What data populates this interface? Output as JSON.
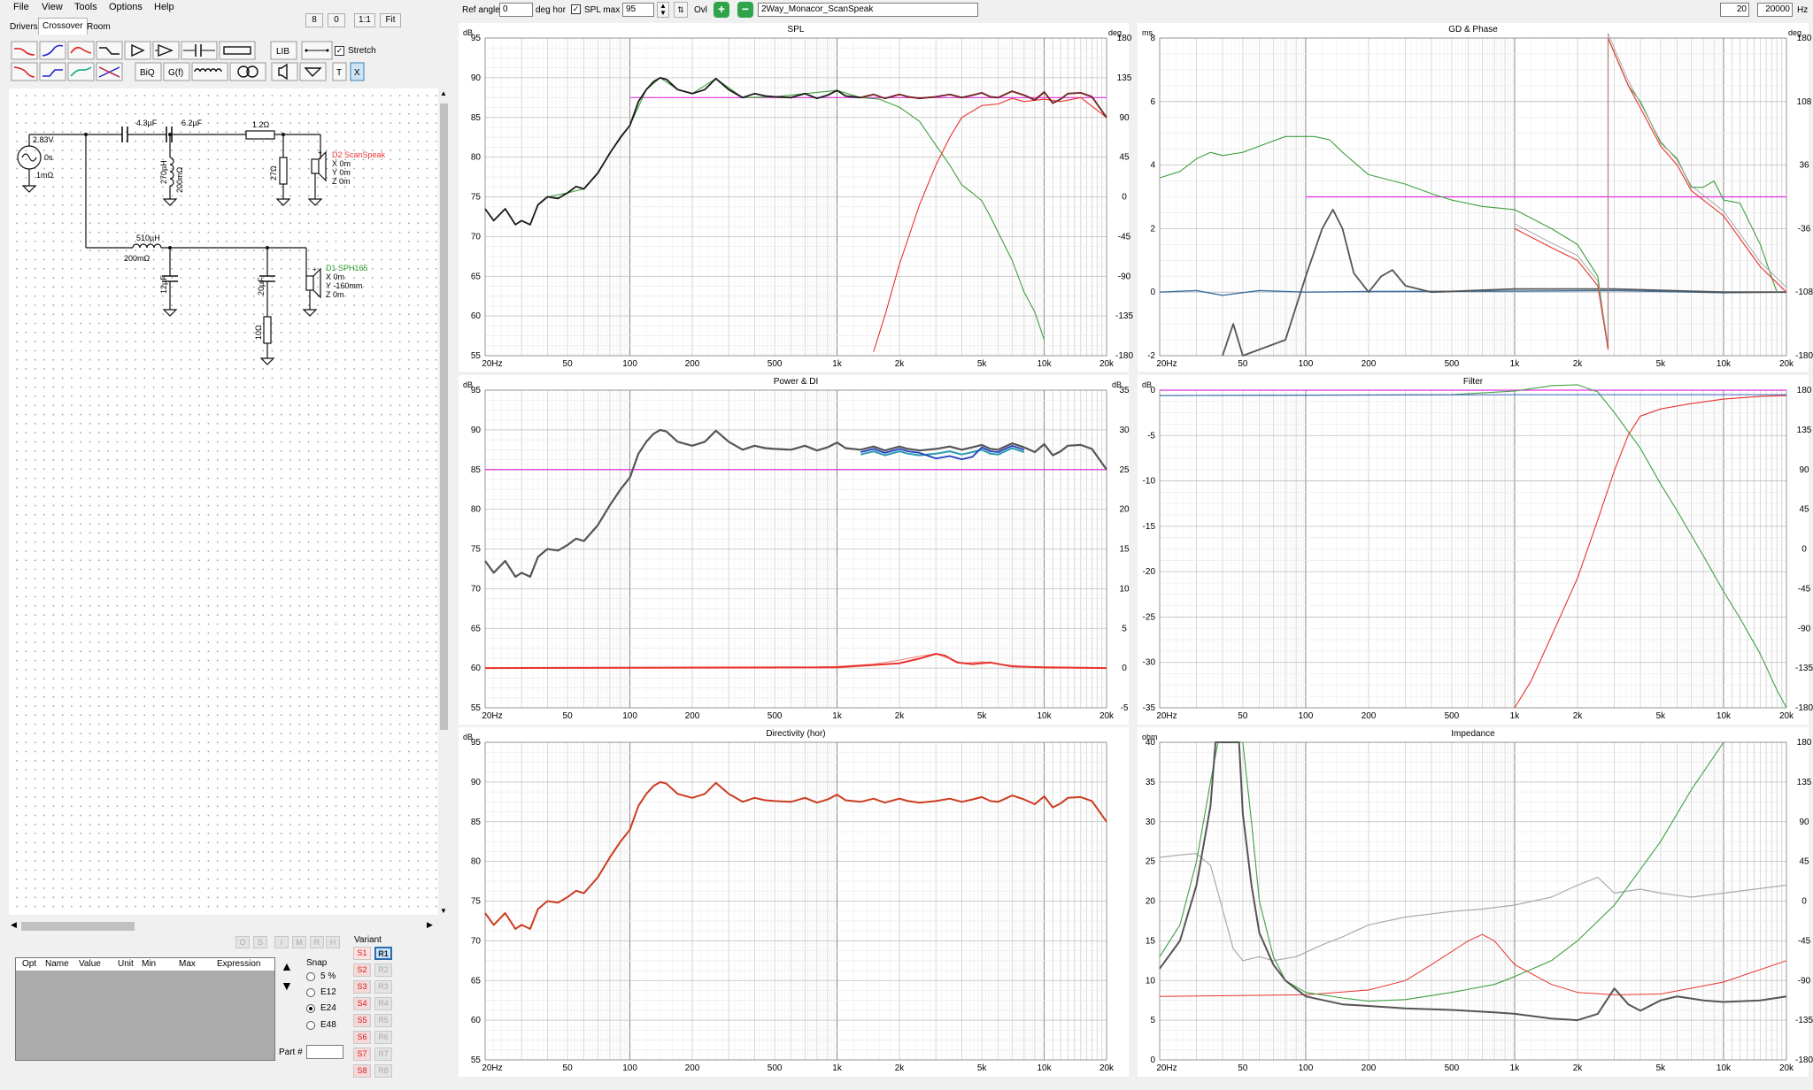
{
  "menu": [
    "File",
    "View",
    "Tools",
    "Options",
    "Help"
  ],
  "zoom_buttons": [
    "8",
    "0",
    "1:1",
    "Fit"
  ],
  "tabs": [
    "Drivers",
    "Crossover",
    "Room"
  ],
  "toolbar": {
    "lib": "LIB",
    "biq": "BiQ",
    "gf": "G(f)",
    "t": "T",
    "x": "X",
    "stretch_label": "Stretch"
  },
  "schematic": {
    "source_v": "2.83V",
    "source_t": "0s",
    "source_r": "1mΩ",
    "c1": "4.3µF",
    "c2": "6.2µF",
    "r1": "1.2Ω",
    "l1": "270µH",
    "l1r": "200mΩ",
    "r2": "27Ω",
    "d2_name": "D2 ScanSpeak",
    "d2_x": "X 0m",
    "d2_y": "Y 0m",
    "d2_z": "Z 0m",
    "l2": "510µH",
    "l2r": "200mΩ",
    "c3": "12µF",
    "c4": "20µF",
    "r3": "10Ω",
    "d1_name": "D1 SPH165",
    "d1_x": "X 0m",
    "d1_y": "Y -160mm",
    "d1_z": "Z 0m"
  },
  "parts_table": {
    "headers": [
      "Opt",
      "Name",
      "Value",
      "Unit",
      "Min",
      "Max",
      "Expression"
    ]
  },
  "part_field_label": "Part #",
  "small_buttons": [
    "O",
    "S",
    "I",
    "M",
    "R",
    "H"
  ],
  "snap": {
    "label": "Snap",
    "options": [
      "5 %",
      "E12",
      "E24",
      "E48"
    ],
    "selected": "E24"
  },
  "variant": {
    "label": "Variant",
    "s": [
      "S1",
      "S2",
      "S3",
      "S4",
      "S5",
      "S6",
      "S7",
      "S8"
    ],
    "r": [
      "R1",
      "R2",
      "R3",
      "R4",
      "R5",
      "R6",
      "R7",
      "R8"
    ]
  },
  "top": {
    "ref_angle_label": "Ref angle",
    "ref_angle": "0",
    "deg_hor": "deg hor",
    "spl_max_label": "SPL max",
    "spl_max": "95",
    "ovl": "Ovl",
    "project": "2Way_Monacor_ScanSpeak",
    "f_min": "20",
    "f_max": "20000",
    "hz": "Hz"
  },
  "colors": {
    "woofer": "#3f9f3f",
    "tweeter": "#e8332b",
    "sum": "#1a1a1a",
    "target": "#e030e0",
    "dir": "#cc3b1f",
    "blue": "#1f3fbf",
    "teal": "#2a9ab0",
    "grey": "#555555",
    "ltgrey": "#aaaaaa"
  },
  "x_ticks": [
    "20Hz",
    "50",
    "100",
    "200",
    "500",
    "1k",
    "2k",
    "5k",
    "10k",
    "20k"
  ],
  "plots": {
    "spl": {
      "title": "SPL",
      "yunit": "dB",
      "y2unit": "deg",
      "y": [
        "95",
        "90",
        "85",
        "80",
        "75",
        "70",
        "65",
        "60",
        "55"
      ],
      "y2": [
        "180",
        "135",
        "90",
        "45",
        "0",
        "-45",
        "-90",
        "-135",
        "-180"
      ]
    },
    "gd": {
      "title": "GD & Phase",
      "yunit": "ms",
      "y2unit": "deg",
      "y": [
        "8",
        "6",
        "4",
        "2",
        "0",
        "-2"
      ],
      "y2": [
        "180",
        "108",
        "36",
        "-36",
        "-108",
        "-180"
      ]
    },
    "power": {
      "title": "Power & DI",
      "yunit": "dB",
      "y2unit": "dB",
      "y": [
        "95",
        "90",
        "85",
        "80",
        "75",
        "70",
        "65",
        "60",
        "55"
      ],
      "y2": [
        "35",
        "30",
        "25",
        "20",
        "15",
        "10",
        "5",
        "0",
        "-5"
      ]
    },
    "filter": {
      "title": "Filter",
      "yunit": "dB",
      "y2unit": "",
      "y": [
        "0",
        "-5",
        "-10",
        "-15",
        "-20",
        "-25",
        "-30",
        "-35"
      ],
      "y2": [
        "180",
        "135",
        "90",
        "45",
        "0",
        "-45",
        "-90",
        "-135",
        "-180"
      ]
    },
    "dir": {
      "title": "Directivity (hor)",
      "yunit": "dB",
      "y2unit": "",
      "y": [
        "95",
        "90",
        "85",
        "80",
        "75",
        "70",
        "65",
        "60",
        "55"
      ],
      "y2": []
    },
    "imp": {
      "title": "Impedance",
      "yunit": "ohm",
      "y2unit": "",
      "y": [
        "40",
        "35",
        "30",
        "25",
        "20",
        "15",
        "10",
        "5",
        "0"
      ],
      "y2": [
        "180",
        "135",
        "90",
        "45",
        "0",
        "-45",
        "-90",
        "-135",
        "-180"
      ]
    }
  }
}
